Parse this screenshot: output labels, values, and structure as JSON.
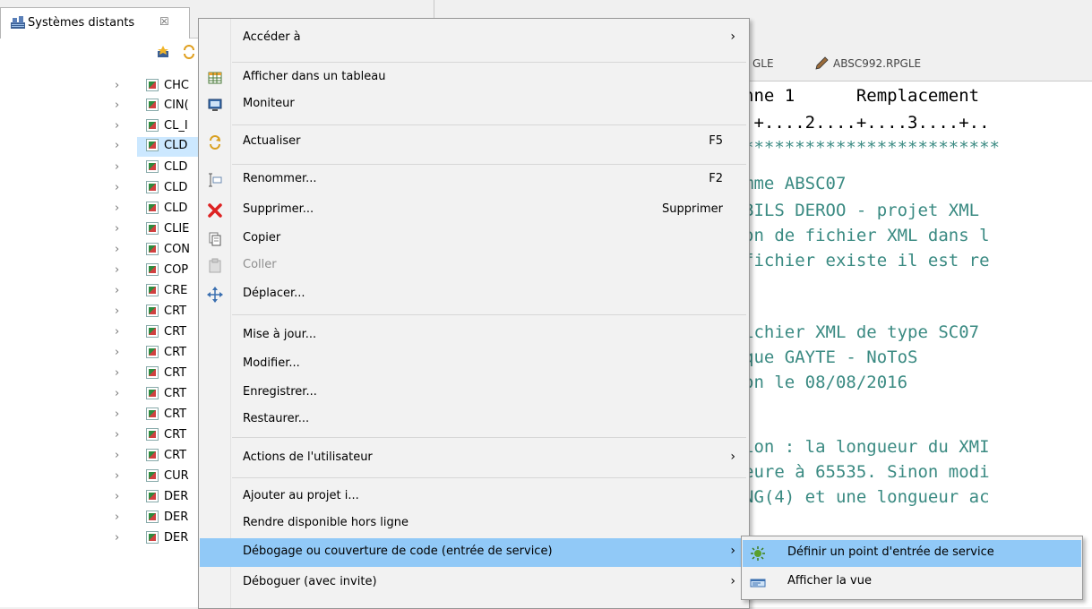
{
  "left_view": {
    "tab_label": "Systèmes distants",
    "tree_items": [
      {
        "name": "CHC",
        "selected": false
      },
      {
        "name": "CIN(",
        "selected": false
      },
      {
        "name": "CL_I",
        "selected": false
      },
      {
        "name": "CLD",
        "selected": true
      },
      {
        "name": "CLD",
        "selected": false
      },
      {
        "name": "CLD",
        "selected": false
      },
      {
        "name": "CLD",
        "selected": false
      },
      {
        "name": "CLIE",
        "selected": false
      },
      {
        "name": "CON",
        "selected": false
      },
      {
        "name": "COP",
        "selected": false
      },
      {
        "name": "CRE",
        "selected": false
      },
      {
        "name": "CRT",
        "selected": false
      },
      {
        "name": "CRT",
        "selected": false
      },
      {
        "name": "CRT",
        "selected": false
      },
      {
        "name": "CRT",
        "selected": false
      },
      {
        "name": "CRT",
        "selected": false
      },
      {
        "name": "CRT",
        "selected": false
      },
      {
        "name": "CRT",
        "selected": false
      },
      {
        "name": "CRT",
        "selected": false
      },
      {
        "name": "CUR",
        "selected": false
      },
      {
        "name": "DER",
        "selected": false
      },
      {
        "name": "DER",
        "selected": false
      },
      {
        "name": "DER",
        "selected": false
      }
    ]
  },
  "editor": {
    "tab_partial": "GLE",
    "tab_file": "ABSC992.RPGLE",
    "ruler_header": "nne 1      Remplacement",
    "ruler": ".+....2....+....3....+..",
    "lines": [
      "*************************",
      "mme ABSC07",
      "BILS DEROO - projet XML",
      "on de fichier XML dans l",
      "fichier existe il est re",
      "",
      "ichier XML de type SC07",
      "que GAYTE - NoToS",
      "on le 08/08/2016",
      "",
      "ion : la longueur du XMI",
      "eure à 65535. Sinon modi",
      "NG(4) et une longueur ac",
      "",
      "",
      ""
    ]
  },
  "context_menu": {
    "items": [
      {
        "label": "Accéder à",
        "shortcut": "",
        "submenu": true
      },
      {
        "label": "Afficher dans un tableau",
        "shortcut": "",
        "icon": "table-icon"
      },
      {
        "label": "Moniteur",
        "shortcut": "",
        "icon": "monitor-icon"
      },
      {
        "label": "Actualiser",
        "shortcut": "F5",
        "icon": "refresh-icon"
      },
      {
        "label": "Renommer...",
        "shortcut": "F2",
        "icon": "rename-icon"
      },
      {
        "label": "Supprimer...",
        "shortcut": "Supprimer",
        "icon": "delete-icon"
      },
      {
        "label": "Copier",
        "shortcut": "",
        "icon": "copy-icon"
      },
      {
        "label": "Coller",
        "shortcut": "",
        "icon": "paste-icon",
        "disabled": true
      },
      {
        "label": "Déplacer...",
        "shortcut": "",
        "icon": "move-icon"
      },
      {
        "label": "Mise à jour...",
        "shortcut": ""
      },
      {
        "label": "Modifier...",
        "shortcut": ""
      },
      {
        "label": "Enregistrer...",
        "shortcut": ""
      },
      {
        "label": "Restaurer...",
        "shortcut": ""
      },
      {
        "label": "Actions de l'utilisateur",
        "shortcut": "",
        "submenu": true
      },
      {
        "label": "Ajouter au projet i...",
        "shortcut": ""
      },
      {
        "label": "Rendre disponible hors ligne",
        "shortcut": ""
      },
      {
        "label": "Débogage ou couverture de code (entrée de service)",
        "shortcut": "",
        "submenu": true,
        "highlighted": true
      },
      {
        "label": "Déboguer (avec invite)",
        "shortcut": "",
        "submenu": true
      }
    ]
  },
  "submenu": {
    "items": [
      {
        "label": "Définir un point d'entrée de service",
        "icon": "service-entry-icon",
        "highlighted": true
      },
      {
        "label": "Afficher la vue",
        "icon": "view-icon"
      }
    ]
  },
  "colors": {
    "menu_highlight": "#91c9f7",
    "tree_selection": "#cce8ff",
    "code_comment": "#3a8a82"
  }
}
